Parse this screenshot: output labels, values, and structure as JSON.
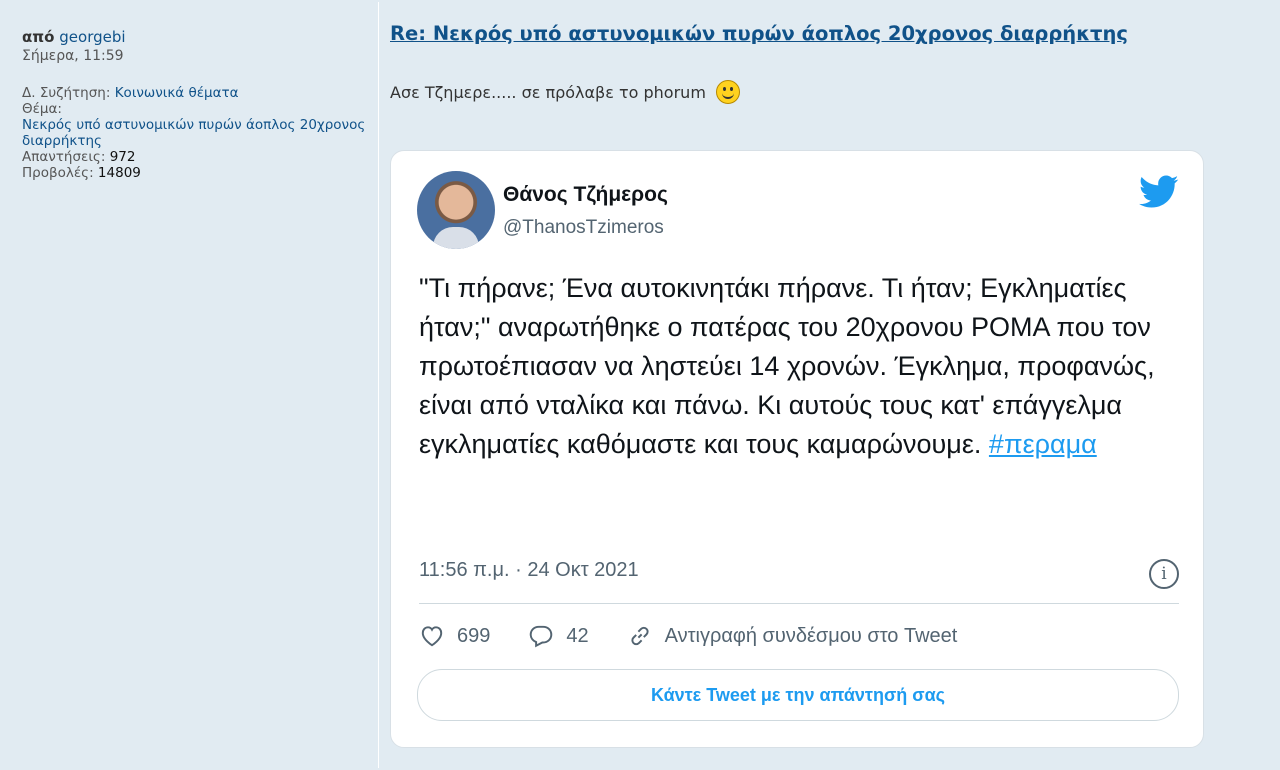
{
  "profile": {
    "by_label": "από",
    "author": "georgebi",
    "date": "Σήμερα, 11:59",
    "discussion_label": "Δ. Συζήτηση:",
    "discussion": "Κοινωνικά θέματα",
    "topic_label": "Θέμα:",
    "topic": "Νεκρός υπό αστυνομικών πυρών άοπλος 20χρονος διαρρήκτης",
    "replies_label": "Απαντήσεις:",
    "replies": "972",
    "views_label": "Προβολές:",
    "views": "14809"
  },
  "post": {
    "title": "Re: Νεκρός υπό αστυνομικών πυρών άοπλος 20χρονος διαρρήκτης",
    "text": "Ασε Τζημερε..... σε πρόλαβε το phorum",
    "emoticon": "smiley-icon"
  },
  "tweet": {
    "name": "Θάνος Τζήμερος",
    "handle": "@ThanosTzimeros",
    "body": "\"Τι πήρανε; Ένα αυτοκινητάκι πήρανε. Τι ήταν; Εγκληματίες ήταν;\" αναρωτήθηκε ο πατέρας του 20χρονου  ΡΟΜΑ που τον πρωτοέπιασαν να ληστεύει 14 χρονών. Έγκλημα, προφανώς, είναι από νταλίκα και πάνω. Κι αυτούς τους κατ' επάγγελμα εγκληματίες καθόμαστε και τους καμαρώνουμε.",
    "hashtag": "#περαμα",
    "time": "11:56 π.μ. · 24 Οκτ 2021",
    "likes": "699",
    "replies": "42",
    "copy_link": "Αντιγραφή συνδέσμου στο Tweet",
    "reply_button": "Κάντε Tweet με την απάντησή σας",
    "accent": "#1d9bf0"
  }
}
